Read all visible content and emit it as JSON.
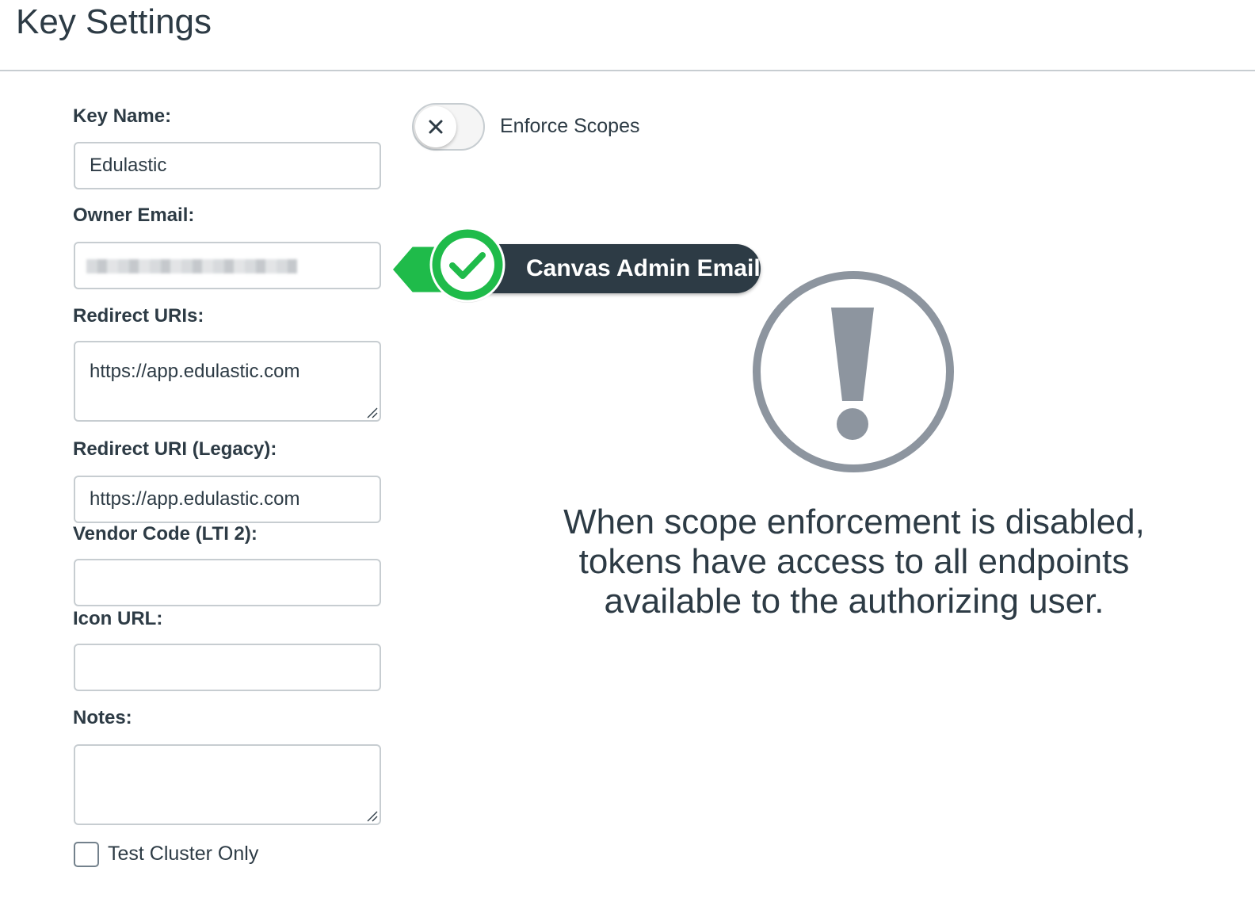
{
  "header": {
    "title": "Key Settings"
  },
  "form": {
    "key_name": {
      "label": "Key Name:",
      "value": "Edulastic"
    },
    "owner_email": {
      "label": "Owner Email:",
      "value_blurred": true
    },
    "redirect_uris": {
      "label": "Redirect URIs:",
      "value": "https://app.edulastic.com"
    },
    "redirect_uri_legacy": {
      "label": "Redirect URI (Legacy):",
      "value": "https://app.edulastic.com"
    },
    "vendor_code": {
      "label": "Vendor Code (LTI 2):",
      "value": ""
    },
    "icon_url": {
      "label": "Icon URL:",
      "value": ""
    },
    "notes": {
      "label": "Notes:",
      "value": ""
    },
    "test_cluster": {
      "label": "Test Cluster Only",
      "checked": false
    }
  },
  "scopes": {
    "label": "Enforce Scopes",
    "enabled": false,
    "icon": "x-icon"
  },
  "callout": {
    "text": "Canvas Admin Email",
    "icon": "check-icon",
    "color": "#1fbb4a"
  },
  "warning": {
    "icon": "exclamation-circle-icon",
    "text": "When scope enforcement is disabled, tokens have access to all endpoints available to the authorizing user."
  },
  "colors": {
    "text": "#2d3b45",
    "border": "#c7cdd1",
    "icon_gray": "#8d959f",
    "accent_green": "#1fbb4a"
  }
}
